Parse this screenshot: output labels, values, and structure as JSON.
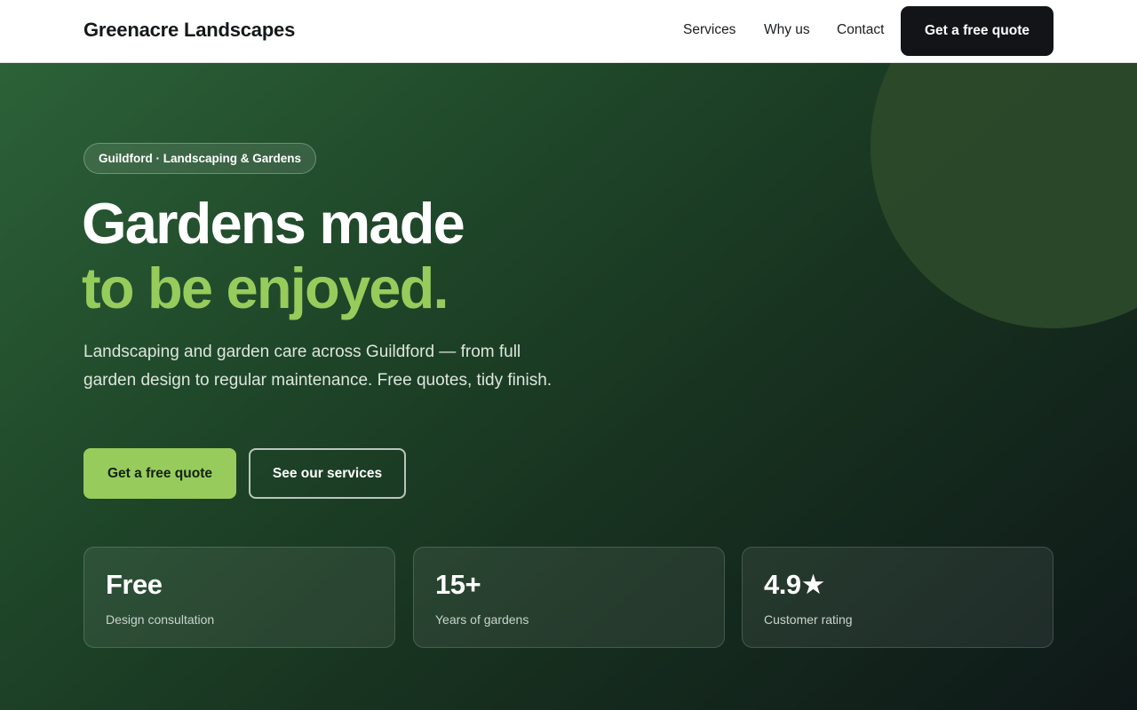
{
  "brand": {
    "name": "Greenacre Landscapes"
  },
  "nav": {
    "items": [
      "Services",
      "Why us",
      "Contact"
    ],
    "cta_label": "Get a free quote"
  },
  "hero": {
    "eyebrow": "Guildford · Landscaping & Gardens",
    "headline_line1": "Gardens made",
    "headline_line2": "to be enjoyed.",
    "subcopy": "Landscaping and garden care across Guildford — from full garden design to regular maintenance. Free quotes, tidy finish.",
    "primary_cta": "Get a free quote",
    "secondary_cta": "See our services"
  },
  "stats": [
    {
      "value": "Free",
      "label": "Design consultation"
    },
    {
      "value": "15+",
      "label": "Years of gardens"
    },
    {
      "value": "4.9★",
      "label": "Customer rating"
    }
  ],
  "colors": {
    "accent": "#97cc5c",
    "dark": "#121417",
    "hero_green": "#2c6238"
  }
}
